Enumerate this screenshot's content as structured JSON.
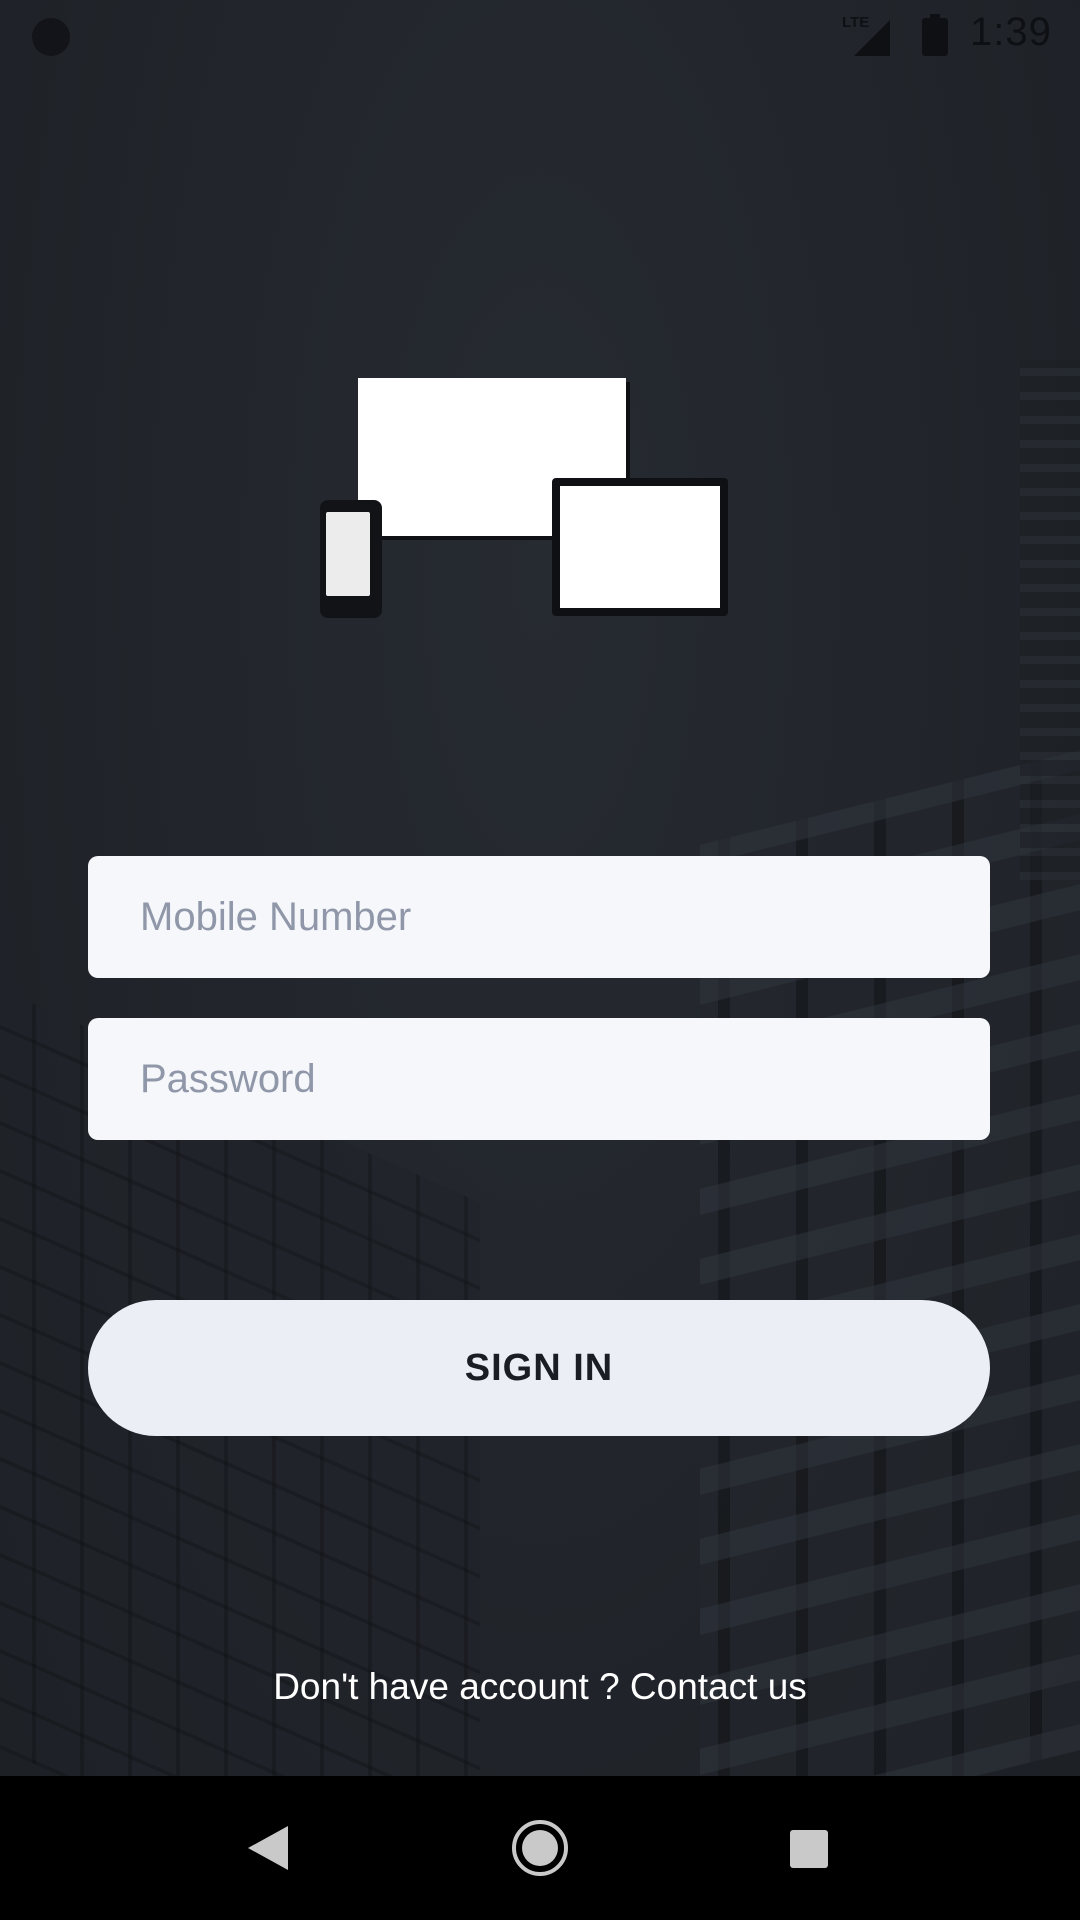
{
  "status_bar": {
    "network_label": "LTE",
    "time": "1:39",
    "icons": [
      "notification-dot-icon",
      "lte-signal-icon",
      "battery-icon"
    ]
  },
  "logo": {
    "icon": "devices-icon"
  },
  "form": {
    "mobile_placeholder": "Mobile Number",
    "mobile_value": "",
    "password_placeholder": "Password",
    "password_value": ""
  },
  "sign_in_label": "SIGN IN",
  "footer_text": "Don't have account ? Contact us",
  "nav_bar": {
    "icons": [
      "back-icon",
      "home-icon",
      "recents-icon"
    ]
  },
  "colors": {
    "background": "#22262c",
    "field_background": "#f6f7fb",
    "button_background": "#eceef6",
    "button_text": "#1a1d24",
    "placeholder_text": "#8f97a8",
    "footer_text": "#ffffff",
    "nav_bar": "#000000"
  }
}
